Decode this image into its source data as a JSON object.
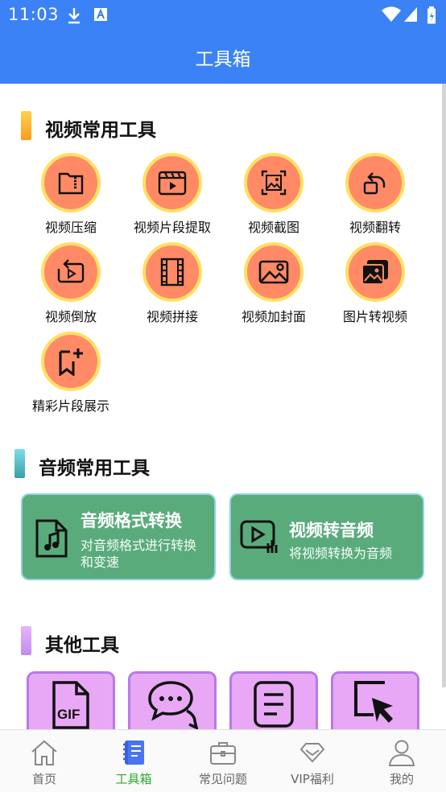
{
  "status_bar": {
    "time": "11:03"
  },
  "header": {
    "title": "工具箱"
  },
  "sections": {
    "video": {
      "title": "视频常用工具",
      "items": [
        {
          "label": "视频压缩",
          "icon": "zip-folder-icon"
        },
        {
          "label": "视频片段提取",
          "icon": "clapperboard-icon"
        },
        {
          "label": "视频截图",
          "icon": "image-crop-icon"
        },
        {
          "label": "视频翻转",
          "icon": "rotate-icon"
        },
        {
          "label": "视频倒放",
          "icon": "reverse-play-icon"
        },
        {
          "label": "视频拼接",
          "icon": "film-strip-icon"
        },
        {
          "label": "视频加封面",
          "icon": "image-icon"
        },
        {
          "label": "图片转视频",
          "icon": "photos-icon"
        },
        {
          "label": "精彩片段展示",
          "icon": "bookmark-add-icon"
        }
      ]
    },
    "audio": {
      "title": "音频常用工具",
      "cards": [
        {
          "title": "音频格式转换",
          "desc_line1": "对音频格式进行转换",
          "desc_line2": "和变速",
          "icon": "music-file-icon"
        },
        {
          "title": "视频转音频",
          "desc_line1": "将视频转换为音频",
          "desc_line2": "",
          "icon": "video-to-audio-icon"
        }
      ]
    },
    "other": {
      "title": "其他工具",
      "items": [
        {
          "icon": "gif-file-icon"
        },
        {
          "icon": "chat-bubbles-icon"
        },
        {
          "icon": "document-icon"
        },
        {
          "icon": "cursor-select-icon"
        }
      ]
    }
  },
  "bottom_nav": [
    {
      "label": "首页",
      "icon": "home-icon",
      "active": false
    },
    {
      "label": "工具箱",
      "icon": "toolbox-icon",
      "active": true
    },
    {
      "label": "常见问题",
      "icon": "briefcase-icon",
      "active": false
    },
    {
      "label": "VIP福利",
      "icon": "diamond-icon",
      "active": false
    },
    {
      "label": "我的",
      "icon": "user-icon",
      "active": false
    }
  ],
  "colors": {
    "header": "#3b82f6",
    "tool_circle": "#ff8a65",
    "tool_ring": "#ffe066",
    "audio_card": "#5aab7c",
    "other_tile": "#e9a8f5",
    "nav_active": "#2aa82a"
  }
}
